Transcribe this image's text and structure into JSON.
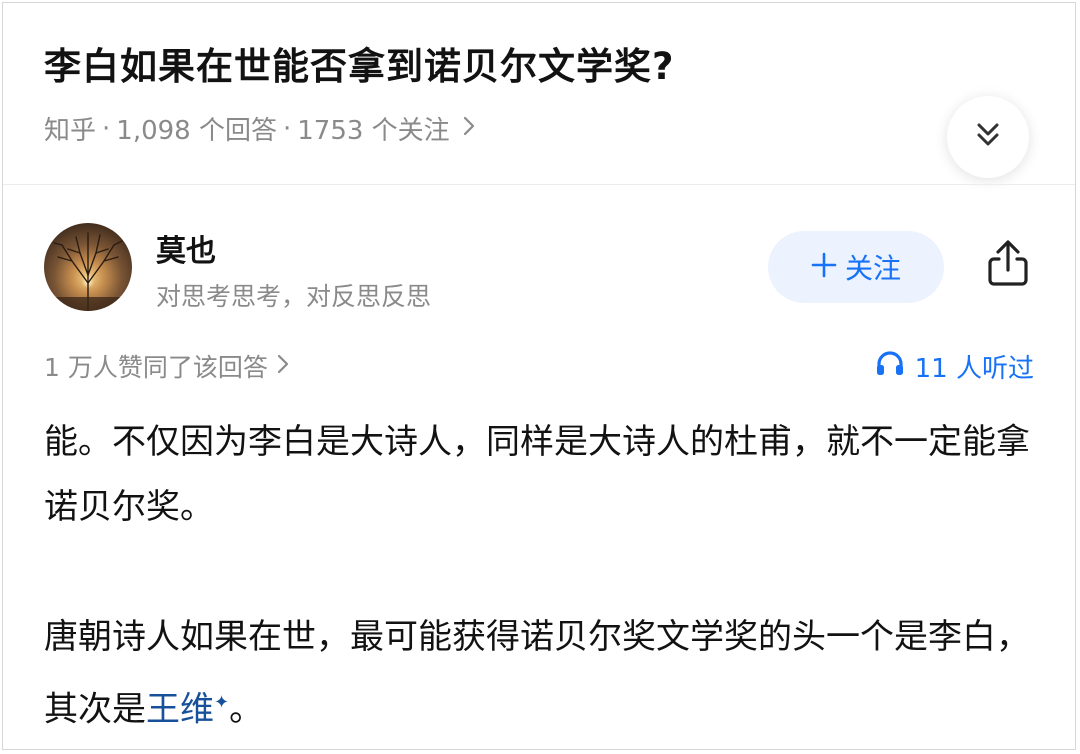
{
  "question": {
    "title": "李白如果在世能否拿到诺贝尔文学奖?",
    "source": "知乎",
    "answers_count": "1,098 个回答",
    "followers_count": "1753 个关注",
    "sep": "·"
  },
  "author": {
    "name": "莫也",
    "bio": "对思考思考，对反思反思",
    "follow_label": "关注"
  },
  "stats": {
    "approvals": "1 万人赞同了该回答",
    "listened": "11 人听过"
  },
  "answer": {
    "p1": "能。不仅因为李白是大诗人，同样是大诗人的杜甫，就不一定能拿诺贝尔奖。",
    "p2_prefix": "唐朝诗人如果在世，最可能获得诺贝尔奖文学奖的头一个是李白，其次是",
    "p2_link": "王维",
    "p2_spark": "✦",
    "p2_suffix": "。"
  },
  "icons": {
    "expand": "double-chevron-down-icon",
    "share": "share-icon",
    "headphones": "headphones-icon",
    "chevron": "chevron-right-icon",
    "plus": "plus-icon"
  },
  "colors": {
    "accent": "#1772f6",
    "link": "#175199",
    "muted": "#8a8a8a"
  }
}
